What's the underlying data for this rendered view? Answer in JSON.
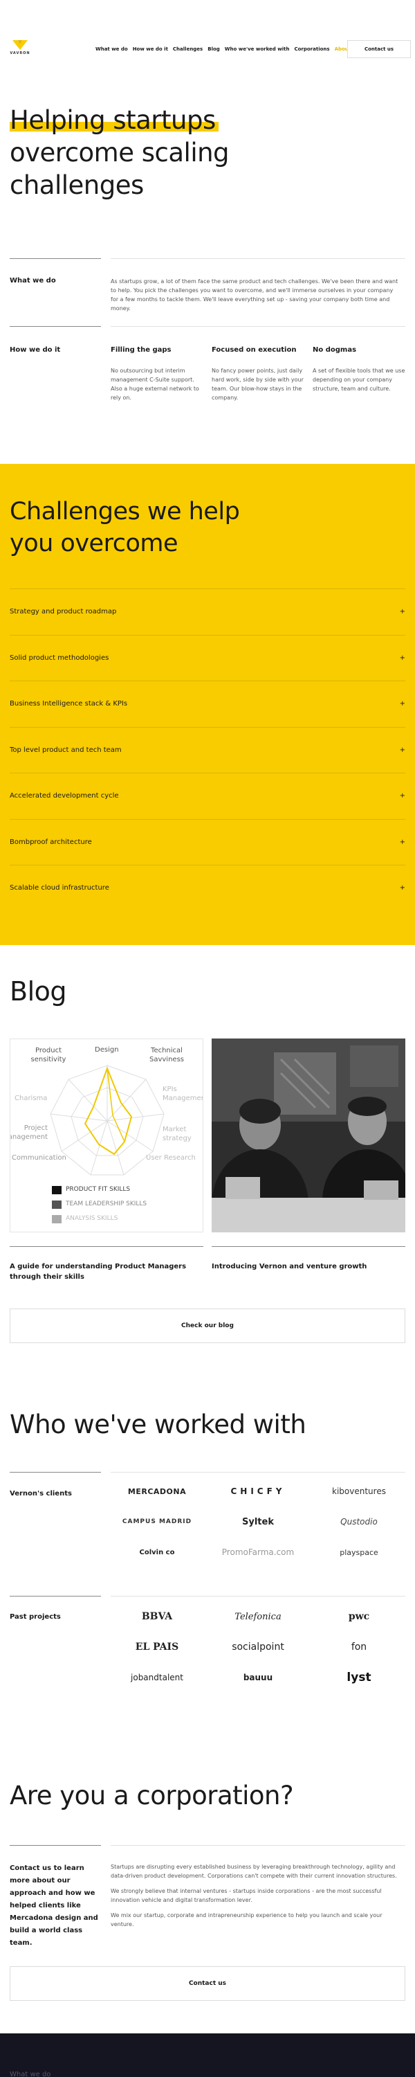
{
  "brand": {
    "name": "VAVRON",
    "accent": "#f9cc00",
    "dark": "#151521"
  },
  "nav": {
    "items": [
      "What we do",
      "How we do it",
      "Challenges",
      "Blog",
      "Who we've worked with",
      "Corporations",
      "About us"
    ],
    "active_index": 6,
    "contact": "Contact us"
  },
  "hero": {
    "line1": "Helping startups",
    "line2": "overcome scaling",
    "line3": "challenges"
  },
  "what_we_do": {
    "heading": "What we do",
    "text": "As startups grow, a lot of them face the same product and tech challenges. We've been there and want to help. You pick the challenges you want to overcome, and we'll immerse ourselves in your company for a few months to tackle them. We'll leave everything set up - saving your company both time and money."
  },
  "how_we_do_it": {
    "heading": "How we do it",
    "columns": [
      {
        "title": "Filling the gaps",
        "text": "No outsourcing but interim management C-Suite support. Also a huge external network to rely on."
      },
      {
        "title": "Focused on execution",
        "text": "No fancy power points, just daily hard work, side by side with your team. Our blow-how stays in the company."
      },
      {
        "title": "No dogmas",
        "text": "A set of flexible tools that we use depending on your company structure, team and culture."
      }
    ]
  },
  "challenges": {
    "heading1": "Challenges we help",
    "heading2": "you overcome",
    "items": [
      "Strategy and product roadmap",
      "Solid product methodologies",
      "Business Intelligence stack & KPIs",
      "Top level product and tech team",
      "Accelerated development cycle",
      "Bombproof architecture",
      "Scalable cloud infrastructure"
    ],
    "expand_symbol": "+"
  },
  "blog": {
    "heading": "Blog",
    "radar_labels": [
      "Design",
      "Technical Savviness",
      "KPIs Management",
      "Market strategy",
      "User Research",
      "Communication",
      "Project management",
      "Charisma",
      "Product sensitivity"
    ],
    "legend": [
      "PRODUCT FIT SKILLS",
      "TEAM LEADERSHIP SKILLS",
      "ANALYSIS SKILLS"
    ],
    "posts": [
      {
        "title": "A guide for understanding Product Managers through their skills"
      },
      {
        "title": "Introducing Vernon and venture growth"
      }
    ],
    "cta": "Check our blog"
  },
  "clients": {
    "heading": "Who we've worked with",
    "vernon_label": "Vernon's clients",
    "vernon_logos": [
      "MERCADONA",
      "CHICFY",
      "kiboventures",
      "CAMPUS MADRID",
      "Syltek",
      "Qustodio",
      "Colvin co",
      "PromoFarma.com",
      "playspace"
    ],
    "past_label": "Past projects",
    "past_logos": [
      "BBVA",
      "Telefonica",
      "pwc",
      "EL PAIS",
      "socialpoint",
      "fon",
      "jobandtalent",
      "bauuu",
      "lyst"
    ]
  },
  "corporation": {
    "heading": "Are you a corporation?",
    "lead": "Contact us to learn more about our approach and how we helped clients like Mercadona design and build a world class team.",
    "paragraphs": [
      "Startups are disrupting every established business by leveraging breakthrough technology, agility and data-driven product development. Corporations can't compete with their current innovation structures.",
      "We strongly believe that internal ventures - startups inside corporations - are the most successful innovation vehicle and digital transformation lever.",
      "We mix our startup, corporate and intrapreneurship experience to help you launch and scale your venture."
    ],
    "cta": "Contact us"
  },
  "footer": {
    "label": "What we do"
  }
}
